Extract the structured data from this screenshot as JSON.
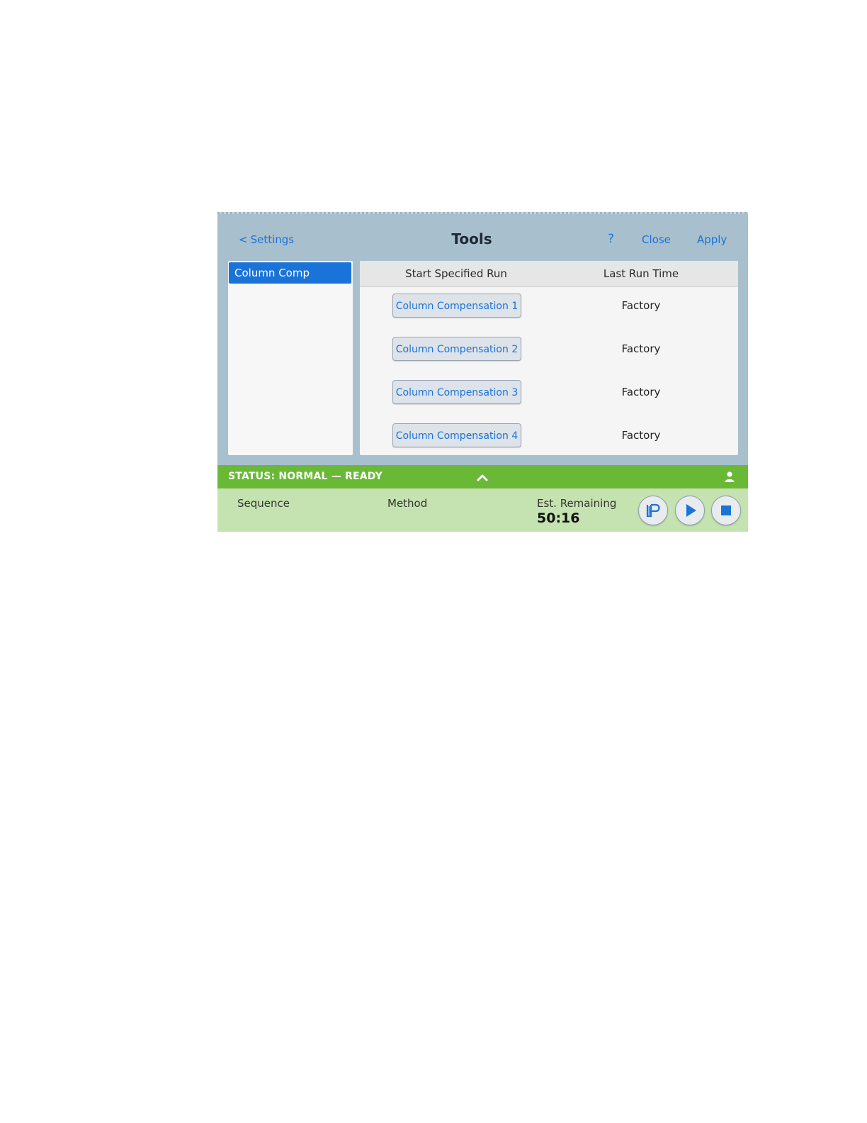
{
  "header": {
    "back_label": "Settings",
    "title": "Tools",
    "help_label": "?",
    "close_label": "Close",
    "apply_label": "Apply"
  },
  "sidebar": {
    "items": [
      {
        "label": "Column Comp",
        "selected": true
      }
    ]
  },
  "table": {
    "columns": [
      "Start Specified Run",
      "Last Run Time"
    ],
    "rows": [
      {
        "run": "Column Compensation 1",
        "last_run": "Factory"
      },
      {
        "run": "Column Compensation 2",
        "last_run": "Factory"
      },
      {
        "run": "Column Compensation 3",
        "last_run": "Factory"
      },
      {
        "run": "Column Compensation 4",
        "last_run": "Factory"
      }
    ]
  },
  "status": {
    "text": "STATUS: NORMAL — READY",
    "color": "#6ab936"
  },
  "info": {
    "sequence_label": "Sequence",
    "method_label": "Method",
    "est_remaining_label": "Est. Remaining",
    "est_remaining_value": "50:16"
  },
  "icons": {
    "back": "chevron-left-icon",
    "expand": "chevron-up-icon",
    "user": "user-icon",
    "inject": "inject-icon",
    "play": "play-icon",
    "stop": "stop-icon"
  },
  "colors": {
    "accent": "#1a73d9",
    "frame": "#a8bfce",
    "info_bar": "#c5e3b0"
  }
}
